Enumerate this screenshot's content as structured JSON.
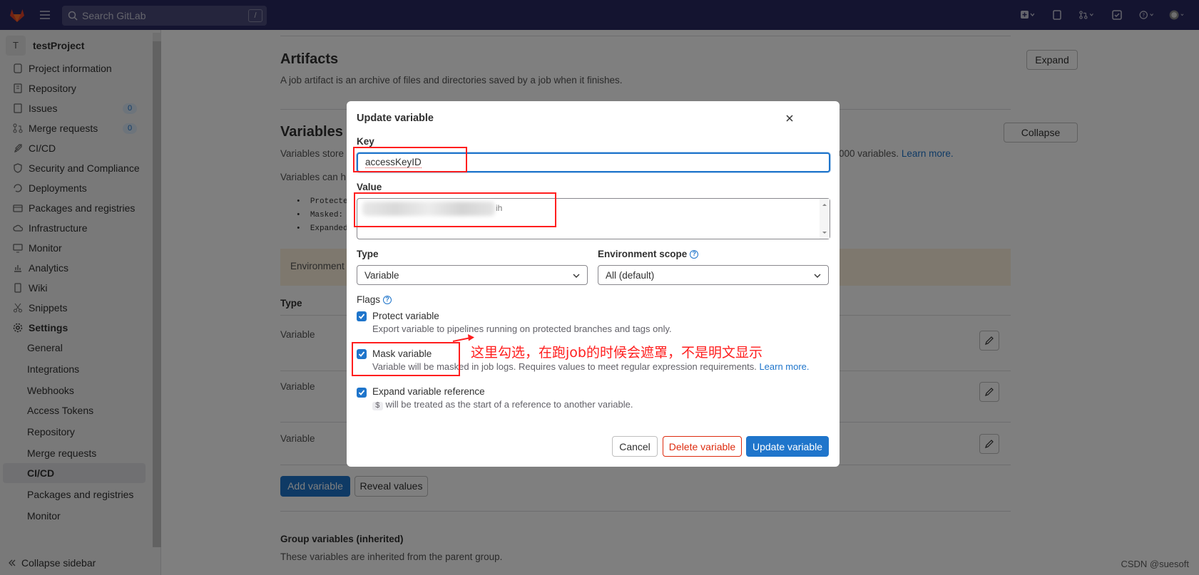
{
  "topbar": {
    "search_placeholder": "Search GitLab",
    "search_shortcut": "/"
  },
  "sidebar": {
    "project_initial": "T",
    "project_name": "testProject",
    "items": [
      {
        "label": "Project information",
        "icon": "project-info-icon"
      },
      {
        "label": "Repository",
        "icon": "repository-icon"
      },
      {
        "label": "Issues",
        "icon": "issues-icon",
        "count": "0"
      },
      {
        "label": "Merge requests",
        "icon": "merge-request-icon",
        "count": "0"
      },
      {
        "label": "CI/CD",
        "icon": "rocket-icon"
      },
      {
        "label": "Security and Compliance",
        "icon": "shield-icon"
      },
      {
        "label": "Deployments",
        "icon": "deployments-icon"
      },
      {
        "label": "Packages and registries",
        "icon": "package-icon"
      },
      {
        "label": "Infrastructure",
        "icon": "cloud-icon"
      },
      {
        "label": "Monitor",
        "icon": "monitor-icon"
      },
      {
        "label": "Analytics",
        "icon": "chart-icon"
      },
      {
        "label": "Wiki",
        "icon": "book-icon"
      },
      {
        "label": "Snippets",
        "icon": "scissors-icon"
      },
      {
        "label": "Settings",
        "icon": "gear-icon"
      }
    ],
    "settings_sub": [
      "General",
      "Integrations",
      "Webhooks",
      "Access Tokens",
      "Repository",
      "Merge requests",
      "CI/CD",
      "Packages and registries",
      "Monitor"
    ],
    "collapse_label": "Collapse sidebar"
  },
  "main": {
    "artifacts_title": "Artifacts",
    "artifacts_desc": "A job artifact is an archive of files and directories saved by a job when it finishes.",
    "expand_label": "Expand",
    "variables_title": "Variables",
    "variables_desc_start": "Variables store",
    "variables_desc_end": "000 variables.",
    "learn_more": "Learn more.",
    "variables_can": "Variables can h",
    "bullets": [
      "Protecte",
      "Masked:",
      "Expanded"
    ],
    "env_text": "Environment",
    "collapse_label": "Collapse",
    "type_header": "Type",
    "rows": [
      "Variable",
      "Variable",
      "Variable"
    ],
    "add_variable": "Add variable",
    "reveal_values": "Reveal values",
    "group_title": "Group variables (inherited)",
    "group_desc": "These variables are inherited from the parent group."
  },
  "modal": {
    "title": "Update variable",
    "key_label": "Key",
    "key_value": "accessKeyID",
    "value_label": "Value",
    "value_tail": "ih",
    "type_label": "Type",
    "type_value": "Variable",
    "env_scope_label": "Environment scope",
    "env_scope_value": "All (default)",
    "flags_label": "Flags",
    "protect_label": "Protect variable",
    "protect_help": "Export variable to pipelines running on protected branches and tags only.",
    "mask_label": "Mask variable",
    "mask_help": "Variable will be masked in job logs. Requires values to meet regular expression requirements.",
    "mask_learn_more": "Learn more.",
    "expand_label": "Expand variable reference",
    "expand_chip": "$",
    "expand_help": "will be treated as the start of a reference to another variable.",
    "cancel": "Cancel",
    "delete": "Delete variable",
    "update": "Update variable"
  },
  "annotation": {
    "text": "这里勾选，在跑job的时候会遮罩，不是明文显示"
  },
  "watermark": "CSDN @suesoft",
  "colors": {
    "topbar": "#292961",
    "primary": "#1f75cb",
    "danger": "#dd2b0e",
    "annotation": "#ff1e1e"
  }
}
